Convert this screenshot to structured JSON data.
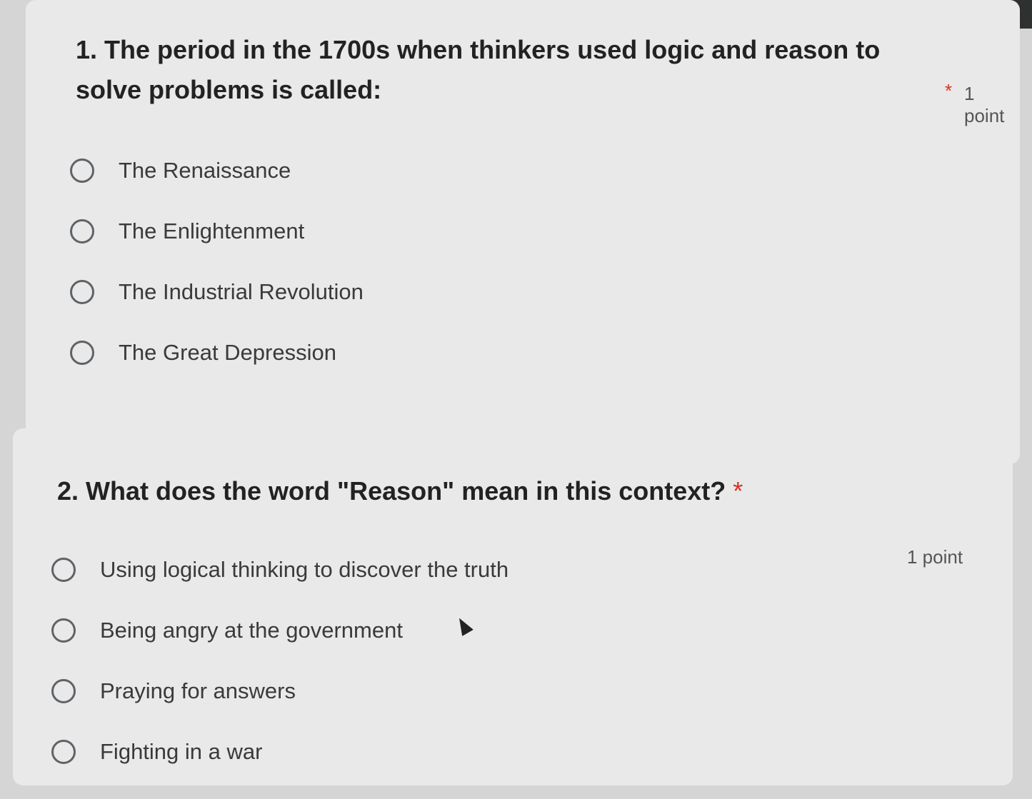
{
  "questions": [
    {
      "title": "1. The period in the 1700s when thinkers used logic and reason to solve problems is called:",
      "required_mark": "*",
      "points": "1 point",
      "options": [
        "The Renaissance",
        "The Enlightenment",
        "The Industrial Revolution",
        "The Great Depression"
      ]
    },
    {
      "title": "2. What does the word \"Reason\" mean in this context?",
      "required_mark": "*",
      "points": "1 point",
      "options": [
        "Using logical thinking to discover the truth",
        "Being angry at the government",
        "Praying for answers",
        "Fighting in a war"
      ]
    }
  ],
  "colors": {
    "page_background": "#d4d5d4",
    "card_background": "#e8e9e8",
    "required_star": "#d93025",
    "radio_border": "#5f6368"
  },
  "icons": {
    "cursor": "mouse-pointer-icon",
    "radio": "radio-unchecked-icon"
  }
}
